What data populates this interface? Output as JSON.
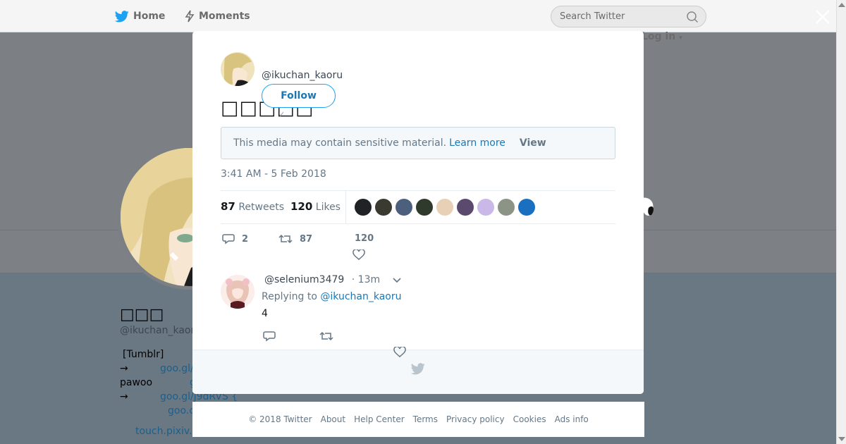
{
  "topnav": {
    "home_label": "Home",
    "moments_label": "Moments",
    "search_placeholder": "Search Twitter",
    "login_label": "Log in"
  },
  "profile": {
    "name": "□□□",
    "handle": "@ikuchan_kaoru",
    "bio_rows": [
      {
        "left": "[Tumblr]",
        "link": ""
      },
      {
        "left": "→",
        "link": "goo.gl/"
      },
      {
        "left": "pawoo",
        "link": "g"
      },
      {
        "left": "→",
        "link": "goo.gl/j9dRVS {"
      },
      {
        "left": "",
        "link": "goo.c"
      }
    ],
    "url": "touch.pixiv."
  },
  "tweet": {
    "author_handle": "@ikuchan_kaoru",
    "follow_label": "Follow",
    "text": "□□□□□",
    "sensitive_notice": "This media may contain sensitive material.",
    "learn_more_label": "Learn more",
    "view_label": "View",
    "timestamp": "3:41 AM - 5 Feb 2018",
    "retweets_count": "87",
    "retweets_label": "Retweets",
    "likes_count": "120",
    "likes_label": "Likes",
    "liker_face_colors": [
      "#1f2326",
      "#3b3a30",
      "#4c607e",
      "#2f3a2c",
      "#e7d0b5",
      "#5b4a6d",
      "#c9b8e8",
      "#8c9486",
      "#1a6fc0"
    ],
    "actions": {
      "reply_count": "2",
      "retweet_count": "87",
      "like_count": "120"
    }
  },
  "reply": {
    "handle": "@selenium3479",
    "time": "· 13m",
    "replying_prefix": "Replying to",
    "replying_to": "@ikuchan_kaoru",
    "text": "4"
  },
  "footer": {
    "links": [
      "© 2018 Twitter",
      "About",
      "Help Center",
      "Terms",
      "Privacy policy",
      "Cookies",
      "Ads info"
    ]
  },
  "colors": {
    "accent": "#1da1f2",
    "link": "#1b78b4",
    "overlay": "#7a8088"
  }
}
